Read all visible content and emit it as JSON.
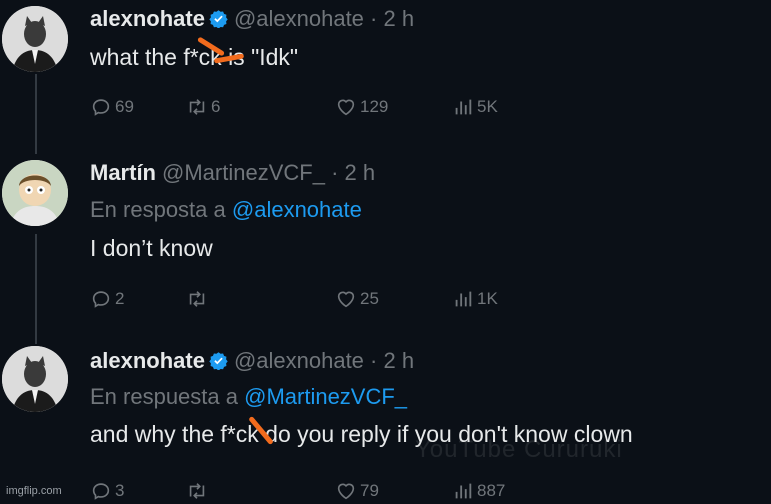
{
  "tweets": [
    {
      "name": "alexnohate",
      "handle": "@alexnohate",
      "time": "· 2 h",
      "text": "what the f*ck is \"Idk\"",
      "stats": {
        "replies": "69",
        "retweets": "6",
        "likes": "129",
        "views": "5K"
      }
    },
    {
      "name": "Martín",
      "handle": "@MartinezVCF_",
      "time": "· 2 h",
      "replying_prefix": "En resposta a ",
      "replying_to": "@alexnohate",
      "text": "I don’t know",
      "stats": {
        "replies": "2",
        "retweets": "",
        "likes": "25",
        "views": "1K"
      }
    },
    {
      "name": "alexnohate",
      "handle": "@alexnohate",
      "time": "· 2 h",
      "replying_prefix": "En respuesta a ",
      "replying_to": "@MartinezVCF_",
      "text": "and why the f*ck do you reply if you don't know clown",
      "stats": {
        "replies": "3",
        "retweets": "",
        "likes": "79",
        "views": "887"
      }
    }
  ],
  "watermark": "YouTube Cururuki",
  "imgflip": "imgflip.com",
  "colors": {
    "background": "#0b1017",
    "accent": "#1d9bf0",
    "muted": "#71767b",
    "censor": "#f26b1d"
  }
}
